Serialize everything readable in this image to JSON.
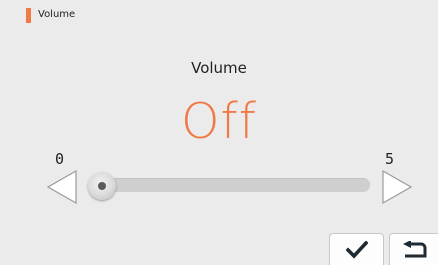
{
  "header": {
    "title": "Volume"
  },
  "main": {
    "setting_label": "Volume",
    "value_display": "Off",
    "scale": {
      "min_label": "0",
      "max_label": "5"
    },
    "slider": {
      "min": 0,
      "max": 5,
      "value": 0
    }
  },
  "footer": {
    "confirm_icon": "checkmark-icon",
    "back_icon": "return-arrow-icon"
  },
  "colors": {
    "accent": "#f07a46",
    "background": "#ebebeb"
  }
}
